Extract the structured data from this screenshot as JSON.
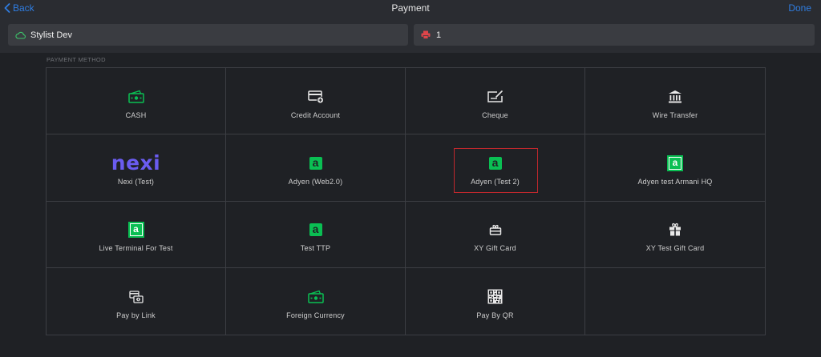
{
  "header": {
    "back_label": "Back",
    "title": "Payment",
    "done_label": "Done"
  },
  "fields": {
    "stylist": {
      "icon": "cloud-icon",
      "value": "Stylist Dev"
    },
    "printer": {
      "icon": "printer-icon",
      "value": "1"
    }
  },
  "section_label": "PAYMENT METHOD",
  "methods": [
    {
      "label": "CASH",
      "icon": "cash-icon"
    },
    {
      "label": "Credit Account",
      "icon": "credit-account-icon"
    },
    {
      "label": "Cheque",
      "icon": "cheque-icon"
    },
    {
      "label": "Wire Transfer",
      "icon": "bank-icon"
    },
    {
      "label": "Nexi (Test)",
      "icon": "nexi-logo-icon",
      "logo_text": "nexi"
    },
    {
      "label": "Adyen (Web2.0)",
      "icon": "adyen-icon",
      "logo_text": "a"
    },
    {
      "label": "Adyen (Test 2)",
      "icon": "adyen-icon",
      "logo_text": "a",
      "selected": true
    },
    {
      "label": "Adyen test Armani HQ",
      "icon": "adyen-boxed-icon",
      "logo_text": "a"
    },
    {
      "label": "Live Terminal For Test",
      "icon": "adyen-boxed-icon",
      "logo_text": "a"
    },
    {
      "label": "Test TTP",
      "icon": "adyen-icon",
      "logo_text": "a"
    },
    {
      "label": "XY Gift Card",
      "icon": "gift-card-icon"
    },
    {
      "label": "XY Test Gift Card",
      "icon": "gift-icon"
    },
    {
      "label": "Pay by Link",
      "icon": "pay-link-icon"
    },
    {
      "label": "Foreign Currency",
      "icon": "cash-icon"
    },
    {
      "label": "Pay By QR",
      "icon": "qr-code-icon"
    }
  ],
  "colors": {
    "accent_blue": "#2f7de1",
    "adyen_green": "#0abf53",
    "nexi_purple": "#6a5cf0",
    "selected_border": "#c0282d",
    "printer_red": "#e0454a"
  }
}
